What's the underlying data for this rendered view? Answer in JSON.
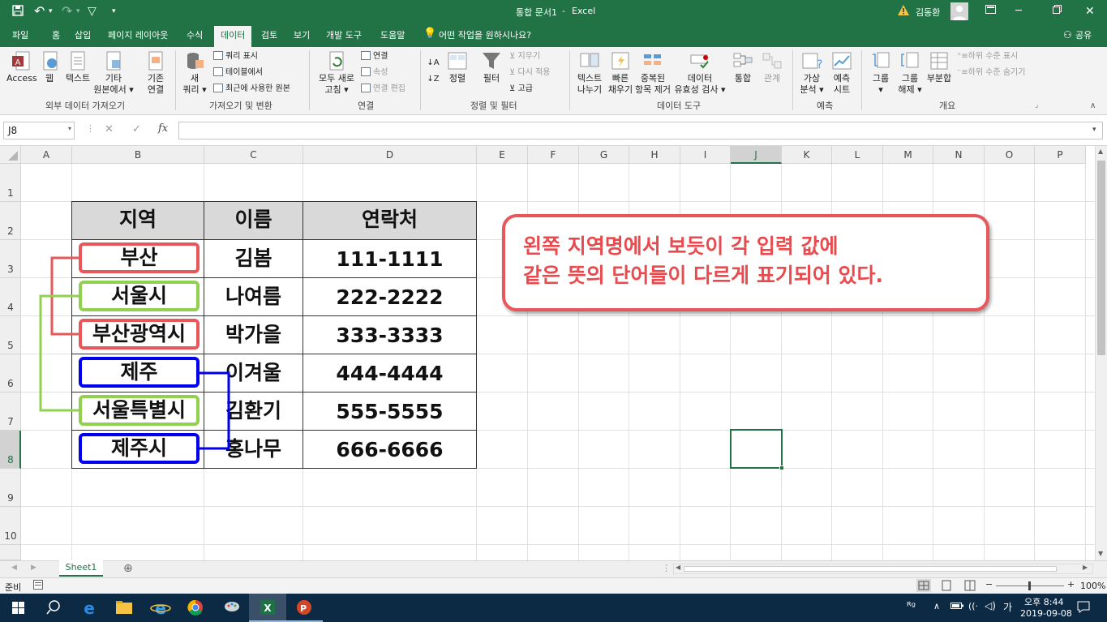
{
  "window": {
    "title": "통합 문서1",
    "app": "Excel",
    "separator": "-",
    "user": "김동환"
  },
  "tabs": [
    {
      "label": "파일"
    },
    {
      "label": "홈"
    },
    {
      "label": "삽입"
    },
    {
      "label": "페이지 레이아웃"
    },
    {
      "label": "수식"
    },
    {
      "label": "데이터"
    },
    {
      "label": "검토"
    },
    {
      "label": "보기"
    },
    {
      "label": "개발 도구"
    },
    {
      "label": "도움말"
    }
  ],
  "tell_me": "어떤 작업을 원하시나요?",
  "share": "공유",
  "ribbon": {
    "groups": [
      "외부 데이터 가져오기",
      "가져오기 및 변환",
      "연결",
      "정렬 및 필터",
      "데이터 도구",
      "예측",
      "개요"
    ],
    "access": "Access",
    "web": "웹",
    "text": "텍스트",
    "other_line1": "기타",
    "other_line2": "원본에서 ▾",
    "existing_line1": "기존",
    "existing_line2": "연결",
    "newquery_line1": "새",
    "newquery_line2": "쿼리 ▾",
    "show_queries": "쿼리 표시",
    "from_table": "테이블에서",
    "recent_sources": "최근에 사용한 원본",
    "refresh_line1": "모두 새로",
    "refresh_line2": "고침 ▾",
    "connections": "연결",
    "properties": "속성",
    "edit_links": "연결 편집",
    "sort": "정렬",
    "filter": "필터",
    "clear": "지우기",
    "reapply": "다시 적용",
    "advanced": "고급",
    "t2c_line1": "텍스트",
    "t2c_line2": "나누기",
    "flash_line1": "빠른",
    "flash_line2": "채우기",
    "dup_line1": "중복된",
    "dup_line2": "항목 제거",
    "valid_line1": "데이터",
    "valid_line2": "유효성 검사 ▾",
    "consolidate": "통합",
    "relations": "관계",
    "whatif_line1": "가상",
    "whatif_line2": "분석 ▾",
    "forecast_line1": "예측",
    "forecast_line2": "시트",
    "group_line1": "그룹",
    "group_line2": "▾",
    "ungroup_line1": "그룹",
    "ungroup_line2": "해제 ▾",
    "subtotal": "부분합",
    "show_detail": "하위 수준 표시",
    "hide_detail": "하위 수준 숨기기"
  },
  "formula_bar": {
    "name_box": "J8",
    "cancel": "✕",
    "enter": "✓",
    "fx": "fx",
    "formula": ""
  },
  "columns": [
    "A",
    "B",
    "C",
    "D",
    "E",
    "F",
    "G",
    "H",
    "I",
    "J",
    "K",
    "L",
    "M",
    "N",
    "O",
    "P"
  ],
  "rows": [
    "1",
    "2",
    "3",
    "4",
    "5",
    "6",
    "7",
    "8",
    "9",
    "10"
  ],
  "table": {
    "headers": [
      "지역",
      "이름",
      "연락처"
    ],
    "rows": [
      [
        "부산",
        "김봄",
        "111-1111"
      ],
      [
        "서울시",
        "나여름",
        "222-2222"
      ],
      [
        "부산광역시",
        "박가을",
        "333-3333"
      ],
      [
        "제주",
        "이겨울",
        "444-4444"
      ],
      [
        "서울특별시",
        "김환기",
        "555-5555"
      ],
      [
        "제주시",
        "홍나무",
        "666-6666"
      ]
    ]
  },
  "callout": {
    "line1": "왼쪽 지역명에서 보듯이 각 입력 값에",
    "line2": "같은 뜻의 단어들이 다르게 표기되어 있다."
  },
  "colors": {
    "accent": "#217346",
    "red": "#e8575a",
    "green": "#92d050",
    "blue": "#0000ee"
  },
  "sheet_tab": "Sheet1",
  "status": {
    "ready": "준비",
    "zoom": "100%"
  },
  "clock": {
    "time": "오후 8:44",
    "date": "2019-09-08",
    "ime": "가"
  }
}
